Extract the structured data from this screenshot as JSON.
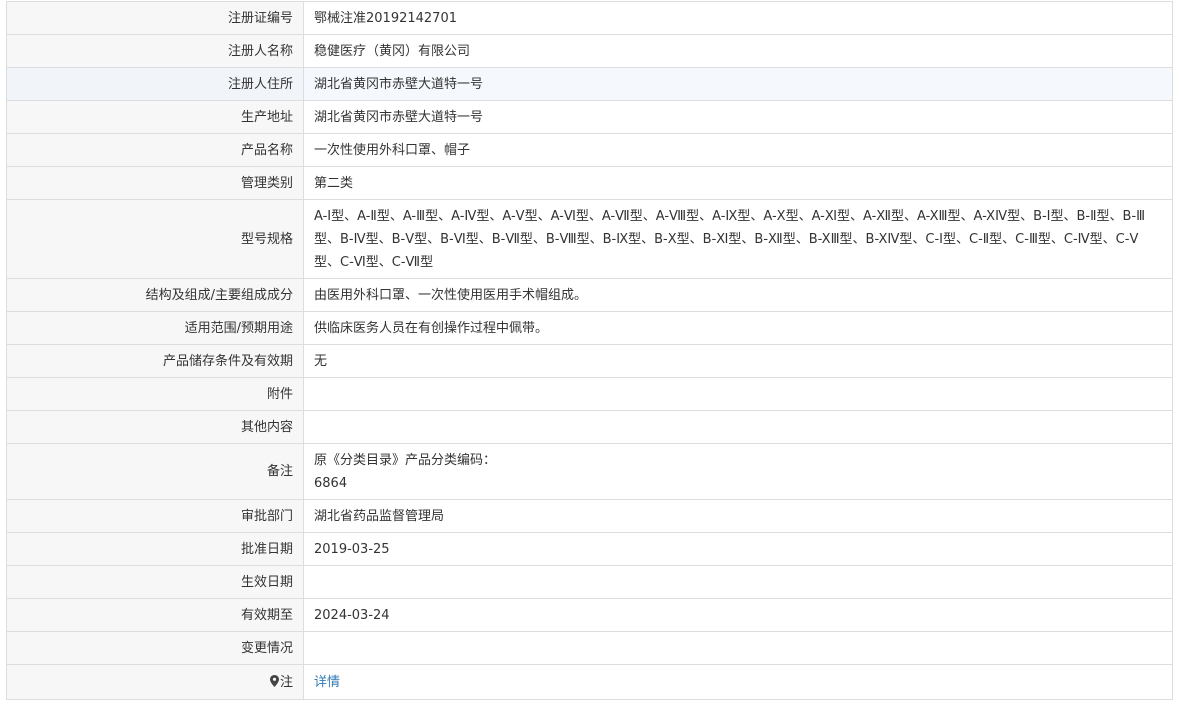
{
  "rows": [
    {
      "label": "注册证编号",
      "value": "鄂械注准20192142701"
    },
    {
      "label": "注册人名称",
      "value": "稳健医疗（黄冈）有限公司"
    },
    {
      "label": "注册人住所",
      "value": "湖北省黄冈市赤壁大道特一号"
    },
    {
      "label": "生产地址",
      "value": "湖北省黄冈市赤壁大道特一号"
    },
    {
      "label": "产品名称",
      "value": "一次性使用外科口罩、帽子"
    },
    {
      "label": "管理类别",
      "value": "第二类"
    },
    {
      "label": "型号规格",
      "value": "A-Ⅰ型、A-Ⅱ型、A-Ⅲ型、A-Ⅳ型、A-Ⅴ型、A-Ⅵ型、A-Ⅶ型、A-Ⅷ型、A-Ⅸ型、A-Ⅹ型、A-Ⅺ型、A-Ⅻ型、A-XⅢ型、A-XⅣ型、B-Ⅰ型、B-Ⅱ型、B-Ⅲ型、B-Ⅳ型、B-Ⅴ型、B-Ⅵ型、B-Ⅶ型、B-Ⅷ型、B-Ⅸ型、B-Ⅹ型、B-Ⅺ型、B-Ⅻ型、B-XⅢ型、B-XⅣ型、C-Ⅰ型、C-Ⅱ型、C-Ⅲ型、C-Ⅳ型、C-Ⅴ型、C-Ⅵ型、C-Ⅶ型"
    },
    {
      "label": "结构及组成/主要组成成分",
      "value": "由医用外科口罩、一次性使用医用手术帽组成。"
    },
    {
      "label": "适用范围/预期用途",
      "value": "供临床医务人员在有创操作过程中佩带。"
    },
    {
      "label": "产品储存条件及有效期",
      "value": "无"
    },
    {
      "label": "附件",
      "value": ""
    },
    {
      "label": "其他内容",
      "value": ""
    },
    {
      "label": "备注",
      "value_lines": [
        "原《分类目录》产品分类编码：",
        "6864"
      ]
    },
    {
      "label": "审批部门",
      "value": "湖北省药品监督管理局"
    },
    {
      "label": "批准日期",
      "value": "2019-03-25"
    },
    {
      "label": "生效日期",
      "value": ""
    },
    {
      "label": "有效期至",
      "value": "2024-03-24"
    },
    {
      "label": "变更情况",
      "value": ""
    },
    {
      "label": "注",
      "value": "详情",
      "icon": "map-pin-icon"
    }
  ]
}
